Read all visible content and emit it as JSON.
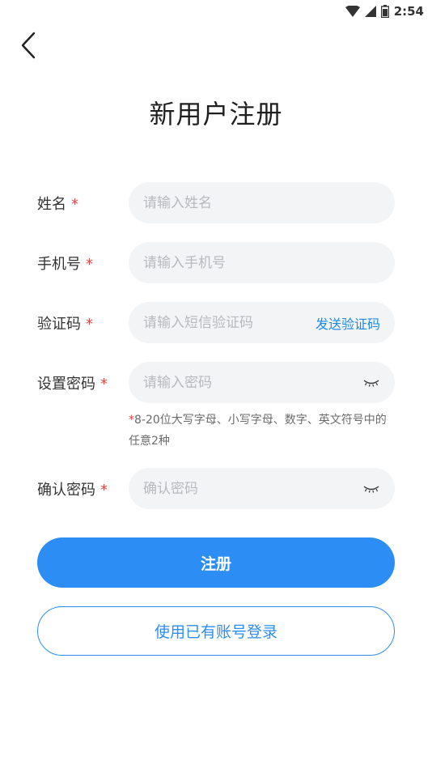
{
  "status_bar": {
    "time": "2:54"
  },
  "header": {
    "title": "新用户注册"
  },
  "form": {
    "name": {
      "label": "姓名",
      "required": "*",
      "placeholder": "请输入姓名"
    },
    "phone": {
      "label": "手机号",
      "required": "*",
      "placeholder": "请输入手机号"
    },
    "code": {
      "label": "验证码",
      "required": "*",
      "placeholder": "请输入短信验证码",
      "send_label": "发送验证码"
    },
    "password": {
      "label": "设置密码",
      "required": "*",
      "placeholder": "请输入密码"
    },
    "password_hint": {
      "star": "*",
      "text": "8-20位大写字母、小写字母、数字、英文符号中的任意2种"
    },
    "confirm": {
      "label": "确认密码",
      "required": "*",
      "placeholder": "确认密码"
    }
  },
  "actions": {
    "register_label": "注册",
    "login_label": "使用已有账号登录"
  },
  "colors": {
    "accent": "#2c8df4",
    "required": "#e84545",
    "field_bg": "#f3f4f6"
  }
}
